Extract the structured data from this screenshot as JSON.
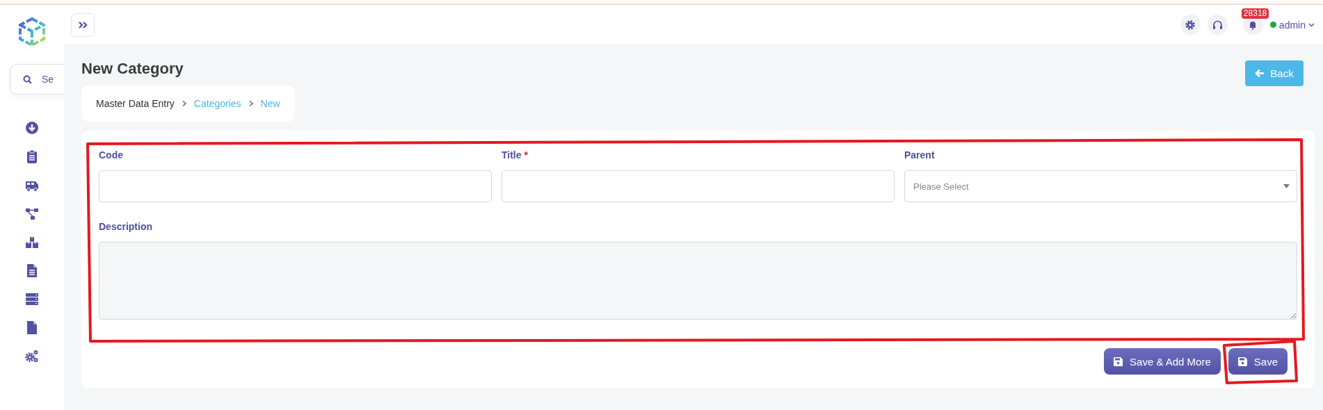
{
  "sidebar": {
    "search": {
      "placeholder": "Se"
    },
    "items": [
      {
        "kind": "download"
      },
      {
        "kind": "clipboard"
      },
      {
        "kind": "bus"
      },
      {
        "kind": "hierarchy"
      },
      {
        "kind": "boxes"
      },
      {
        "kind": "document"
      },
      {
        "kind": "server"
      },
      {
        "kind": "file"
      },
      {
        "kind": "gears"
      }
    ]
  },
  "top_bar": {
    "notification_count": "28318",
    "user": {
      "name": "admin",
      "online": true
    }
  },
  "page": {
    "title": "New Category",
    "back_button": "Back",
    "breadcrumb": [
      {
        "label": "Master Data Entry",
        "link": false
      },
      {
        "label": "Categories",
        "link": true
      },
      {
        "label": "New",
        "link": true
      }
    ]
  },
  "form": {
    "outlined": true,
    "fields": [
      {
        "kind": "text",
        "label": "Code"
      },
      {
        "kind": "text",
        "label": "Title",
        "required_mark": "*"
      },
      {
        "kind": "select",
        "label": "Parent",
        "placeholder": "Please Select"
      },
      {
        "kind": "textarea",
        "label": "Description"
      }
    ],
    "buttons": [
      {
        "label": "Save & Add More",
        "outlined": false
      },
      {
        "label": "Save",
        "outlined": true
      }
    ]
  }
}
